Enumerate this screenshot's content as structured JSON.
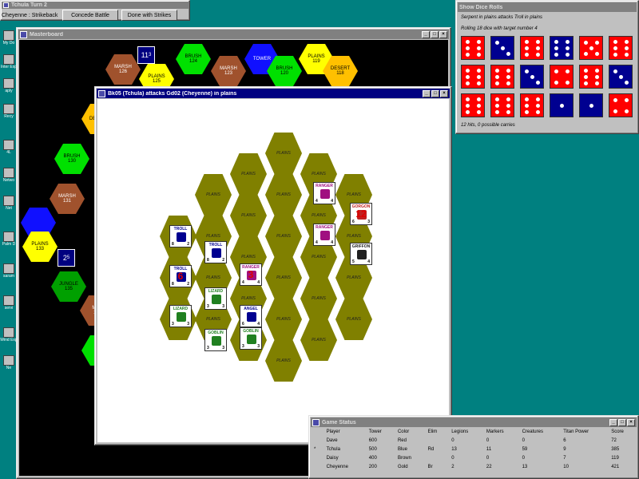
{
  "desktop": {
    "icons": [
      "My Do",
      "Inter Exp",
      "aply",
      "Recy",
      "4L",
      "Netwo",
      "Net",
      "Palm D",
      "saram",
      "servi",
      "Wind Exp",
      "Ne"
    ]
  },
  "control_window": {
    "title": "Tchula Turn 2",
    "phase_label": "Cheyenne : Strikeback",
    "buttons": [
      "Concede Battle",
      "Done with Strikes"
    ]
  },
  "masterboard": {
    "title": "Masterboard",
    "hexes": [
      {
        "terrain": "marsh",
        "label": "MARSH",
        "num": "126"
      },
      {
        "terrain": "plains",
        "label": "PLAINS",
        "num": "125"
      },
      {
        "terrain": "brush",
        "label": "BRUSH",
        "num": "124"
      },
      {
        "terrain": "marsh",
        "label": "MARSH",
        "num": "123"
      },
      {
        "terrain": "tower",
        "label": "TOWER",
        "num": ""
      },
      {
        "terrain": "brush",
        "label": "BRUSH",
        "num": "120"
      },
      {
        "terrain": "plains",
        "label": "PLAINS",
        "num": "119"
      },
      {
        "terrain": "desert",
        "label": "DESERT",
        "num": "118"
      },
      {
        "terrain": "desert",
        "label": "DESERT",
        "num": ""
      },
      {
        "terrain": "brush",
        "label": "BRUSH",
        "num": "130"
      },
      {
        "terrain": "marsh",
        "label": "MARSH",
        "num": "131"
      },
      {
        "terrain": "tower",
        "label": "",
        "num": ""
      },
      {
        "terrain": "plains",
        "label": "PLAINS",
        "num": "133"
      },
      {
        "terrain": "jungle",
        "label": "JUNGLE",
        "num": "135"
      },
      {
        "terrain": "marsh",
        "label": "MAR",
        "num": "136"
      },
      {
        "terrain": "brush",
        "label": "BR",
        "num": ""
      }
    ],
    "legions": [
      {
        "label": "11",
        "sub": "3"
      },
      {
        "label": "2",
        "sub": "5"
      }
    ]
  },
  "battle_window": {
    "title": "Bk05 (Tchula) attacks Gd02 (Cheyenne) in plains",
    "hex_label": "PLAINS",
    "creatures": [
      {
        "name": "TROLL",
        "power": "8",
        "skill": "2",
        "color": "#000090",
        "damage": ""
      },
      {
        "name": "RANGER",
        "power": "4",
        "skill": "4",
        "color": "#a01080",
        "damage": ""
      },
      {
        "name": "GORGON",
        "power": "6",
        "skill": "3",
        "color": "#c02020",
        "damage": "12"
      },
      {
        "name": "GRIFFON",
        "power": "5",
        "skill": "4",
        "color": "#202020",
        "damage": ""
      },
      {
        "name": "RANGER",
        "power": "4",
        "skill": "4",
        "color": "#a01080",
        "damage": ""
      },
      {
        "name": "TROLL",
        "power": "8",
        "skill": "2",
        "color": "#000090",
        "damage": ""
      },
      {
        "name": "TROLL",
        "power": "8",
        "skill": "2",
        "color": "#000090",
        "damage": "6"
      },
      {
        "name": "RANGER",
        "power": "4",
        "skill": "4",
        "color": "#a01080",
        "damage": "3"
      },
      {
        "name": "LIZARD",
        "power": "3",
        "skill": "3",
        "color": "#208020",
        "damage": ""
      },
      {
        "name": "ANGEL",
        "power": "6",
        "skill": "4",
        "color": "#000090",
        "damage": ""
      },
      {
        "name": "LIZARD",
        "power": "3",
        "skill": "3",
        "color": "#208020",
        "damage": ""
      },
      {
        "name": "GOBLIN",
        "power": "3",
        "skill": "3",
        "color": "#208020",
        "damage": ""
      },
      {
        "name": "GOBLIN",
        "power": "3",
        "skill": "3",
        "color": "#208020",
        "damage": ""
      }
    ]
  },
  "dice_window": {
    "title": "Show Dice Rolls",
    "line1": "Serpent in plains attacks Troll in plains",
    "line2": "Rolling 18 dice with target number 4",
    "dice": [
      {
        "color": "red",
        "value": 6
      },
      {
        "color": "blue",
        "value": 3
      },
      {
        "color": "red",
        "value": 6
      },
      {
        "color": "blue",
        "value": 6
      },
      {
        "color": "red",
        "value": 5
      },
      {
        "color": "red",
        "value": 6
      },
      {
        "color": "red",
        "value": 6
      },
      {
        "color": "red",
        "value": 6
      },
      {
        "color": "blue",
        "value": 3
      },
      {
        "color": "red",
        "value": 4
      },
      {
        "color": "red",
        "value": 6
      },
      {
        "color": "blue",
        "value": 3
      },
      {
        "color": "red",
        "value": 6
      },
      {
        "color": "red",
        "value": 6
      },
      {
        "color": "red",
        "value": 6
      },
      {
        "color": "blue",
        "value": 1
      },
      {
        "color": "blue",
        "value": 1
      },
      {
        "color": "red",
        "value": 4
      }
    ],
    "result": "12 hits, 0 possible carries"
  },
  "status_window": {
    "title": "Game Status",
    "columns": [
      "Player",
      "Tower",
      "Color",
      "Elim",
      "Legions",
      "Markers",
      "Creatures",
      "Titan Power",
      "Score"
    ],
    "rows": [
      {
        "mark": "",
        "cells": [
          "Dave",
          "600",
          "Red",
          "",
          "0",
          "0",
          "0",
          "6",
          "72"
        ]
      },
      {
        "mark": "*",
        "cells": [
          "Tchula",
          "500",
          "Blue",
          "Rd",
          "13",
          "11",
          "59",
          "9",
          "385"
        ]
      },
      {
        "mark": "",
        "cells": [
          "Daisy",
          "400",
          "Brown",
          "",
          "0",
          "0",
          "0",
          "7",
          "119"
        ]
      },
      {
        "mark": "",
        "cells": [
          "Cheyenne",
          "200",
          "Gold",
          "Br",
          "2",
          "22",
          "13",
          "10",
          "421"
        ]
      }
    ]
  }
}
